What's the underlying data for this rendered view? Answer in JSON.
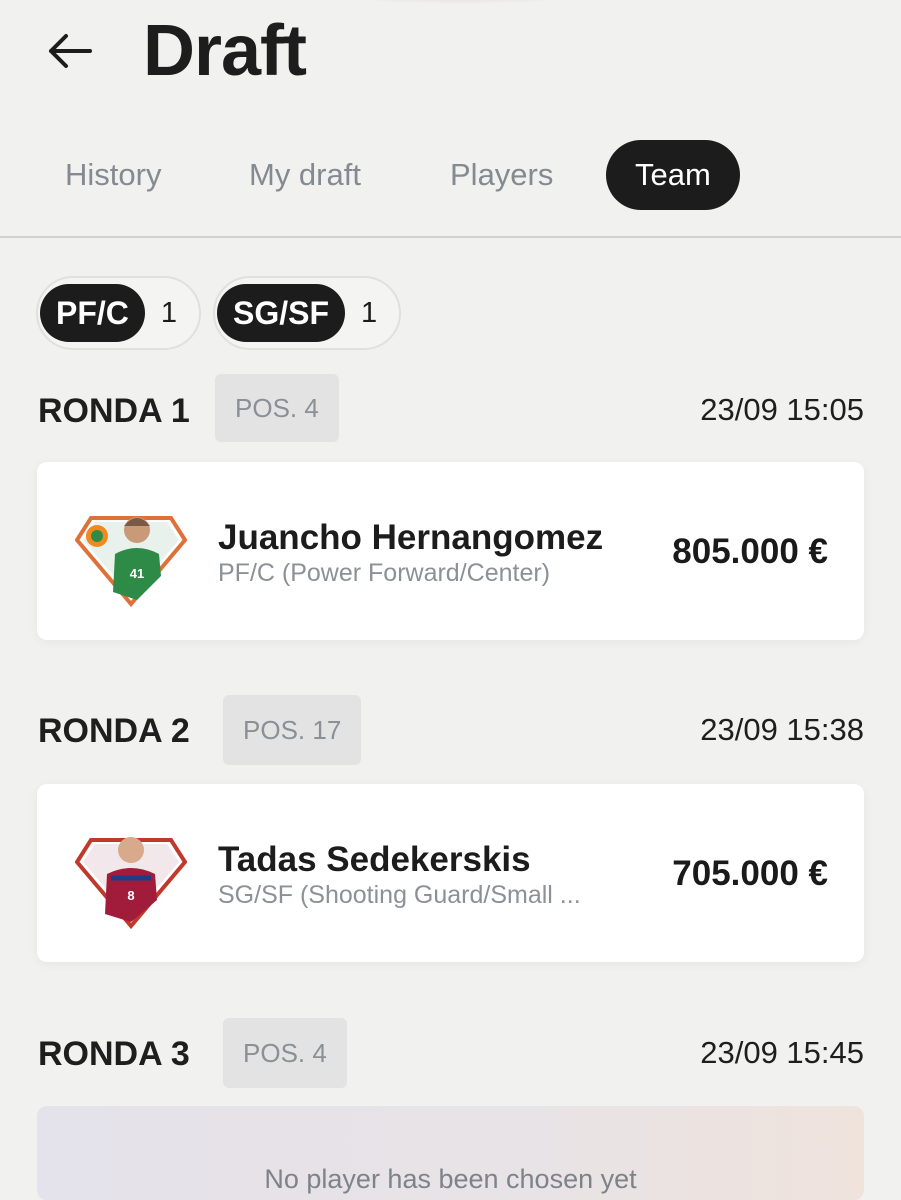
{
  "header": {
    "title": "Draft"
  },
  "tabs": [
    {
      "label": "History"
    },
    {
      "label": "My draft"
    },
    {
      "label": "Players"
    },
    {
      "label": "Team",
      "active": true
    }
  ],
  "position_chips": [
    {
      "tag": "PF/C",
      "count": "1"
    },
    {
      "tag": "SG/SF",
      "count": "1"
    }
  ],
  "rounds": [
    {
      "label": "RONDA 1",
      "pos": "POS. 4",
      "time": "23/09 15:05",
      "player": {
        "name": "Juancho Hernangomez",
        "position": "PF/C (Power Forward/Center)",
        "price": "805.000 €",
        "jersey": "41",
        "team_color": "#2e8b47"
      }
    },
    {
      "label": "RONDA 2",
      "pos": "POS. 17",
      "time": "23/09 15:38",
      "player": {
        "name": "Tadas Sedekerskis",
        "position": "SG/SF (Shooting Guard/Small ...",
        "price": "705.000 €",
        "jersey": "8",
        "team_color": "#a11c3a"
      }
    },
    {
      "label": "RONDA 3",
      "pos": "POS. 4",
      "time": "23/09 15:45",
      "empty_text": "No player has been chosen yet"
    }
  ],
  "colors": {
    "accent": "#1c1c1c",
    "muted": "#8b9197",
    "background": "#f1f1f0"
  },
  "icons": {
    "back": "arrow-left-icon",
    "avatar_frame": "diamond-badge-icon"
  }
}
